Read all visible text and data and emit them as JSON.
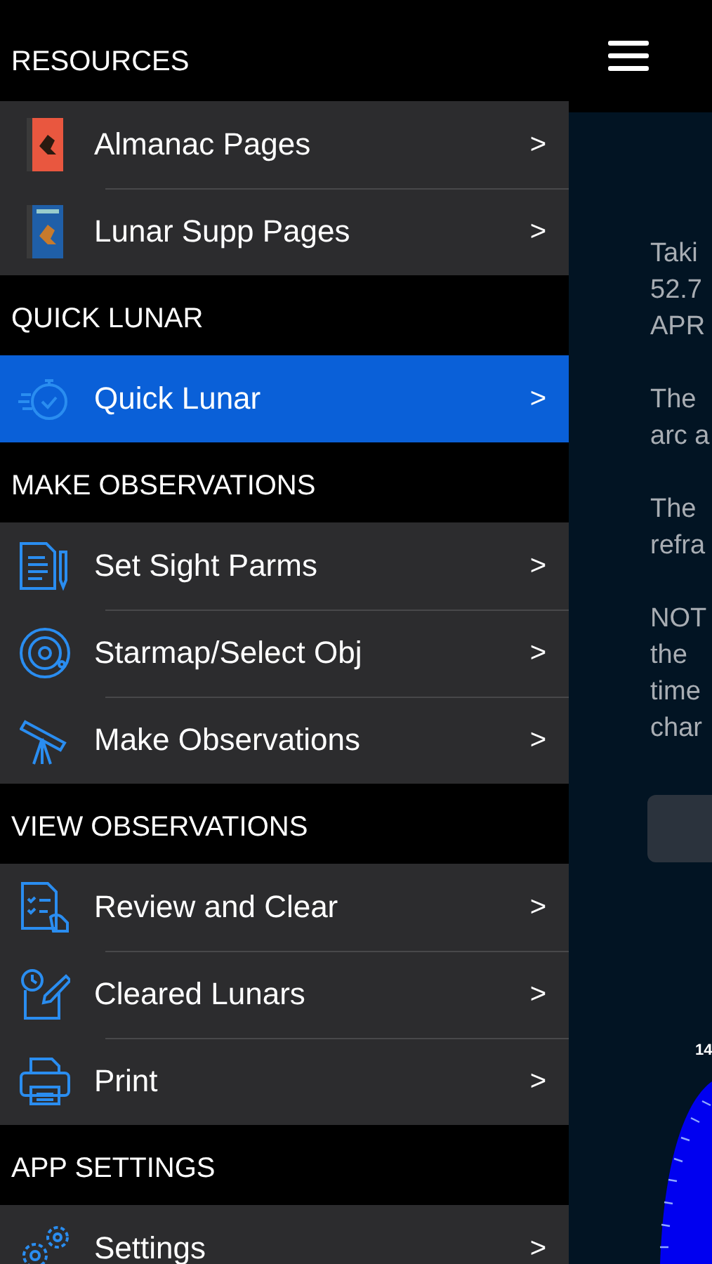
{
  "menu": {
    "sections": [
      {
        "title": "RESOURCES",
        "items": [
          {
            "label": "Almanac Pages",
            "kind": "almanac",
            "selected": false,
            "chevron": ">"
          },
          {
            "label": "Lunar Supp Pages",
            "kind": "supp",
            "selected": false,
            "chevron": ">"
          }
        ]
      },
      {
        "title": "QUICK LUNAR",
        "items": [
          {
            "label": "Quick Lunar",
            "kind": "stopwatch",
            "selected": true,
            "chevron": ">"
          }
        ]
      },
      {
        "title": "MAKE OBSERVATIONS",
        "items": [
          {
            "label": "Set Sight Parms",
            "kind": "document",
            "selected": false,
            "chevron": ">"
          },
          {
            "label": "Starmap/Select Obj",
            "kind": "orbit",
            "selected": false,
            "chevron": ">"
          },
          {
            "label": "Make Observations",
            "kind": "telescope",
            "selected": false,
            "chevron": ">"
          }
        ]
      },
      {
        "title": "VIEW OBSERVATIONS",
        "items": [
          {
            "label": "Review and Clear",
            "kind": "checklist",
            "selected": false,
            "chevron": ">"
          },
          {
            "label": "Cleared Lunars",
            "kind": "clearedlog",
            "selected": false,
            "chevron": ">"
          },
          {
            "label": "Print",
            "kind": "printer",
            "selected": false,
            "chevron": ">"
          }
        ]
      },
      {
        "title": "APP SETTINGS",
        "items": [
          {
            "label": "Settings",
            "kind": "gears",
            "selected": false,
            "chevron": ">"
          }
        ]
      }
    ]
  },
  "main": {
    "paragraphs": [
      [
        "Taki",
        "52.7",
        "APR"
      ],
      [
        "The",
        "arc a"
      ],
      [
        "The",
        "refra"
      ],
      [
        "NOT",
        "the",
        "time",
        "char"
      ]
    ],
    "dial_label": "14"
  }
}
